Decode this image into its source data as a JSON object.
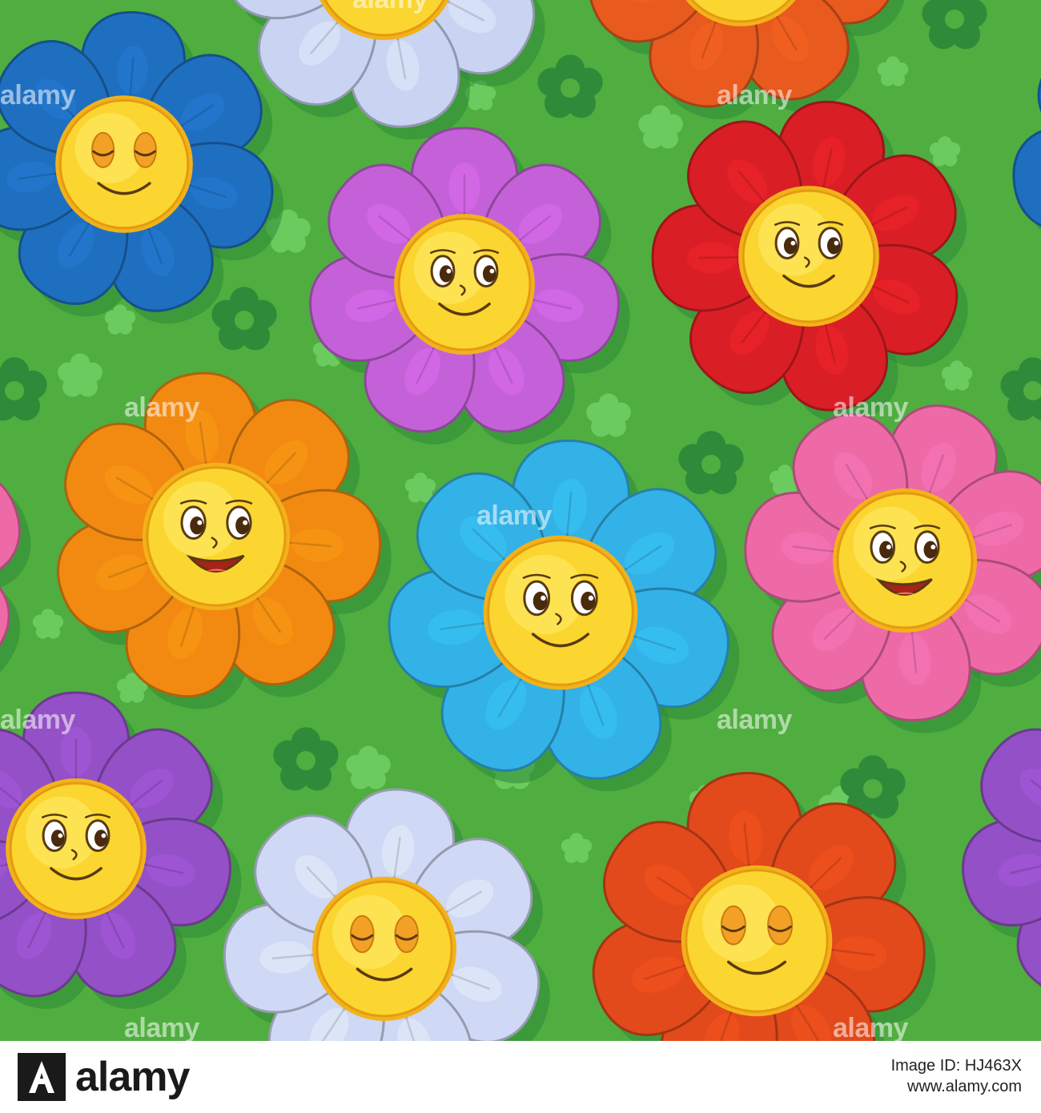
{
  "image": {
    "background_color": "#4fae3f",
    "watermark_text": "alamy",
    "flowers": [
      {
        "petal": "#1f6fc0",
        "face": "sleepy"
      },
      {
        "petal": "#c9d3f2",
        "face": "hidden"
      },
      {
        "petal": "#e85a1e",
        "face": "hidden"
      },
      {
        "petal": "#c561d8",
        "face": "happy"
      },
      {
        "petal": "#d91f25",
        "face": "happy"
      },
      {
        "petal": "#f28a12",
        "face": "laughing"
      },
      {
        "petal": "#33b2e8",
        "face": "happy"
      },
      {
        "petal": "#ee6aa7",
        "face": "laughing"
      },
      {
        "petal": "#9450c6",
        "face": "happy"
      },
      {
        "petal": "#cfd8f4",
        "face": "sleepy"
      },
      {
        "petal": "#e24a1b",
        "face": "sleepy"
      }
    ]
  },
  "footer": {
    "logo_text": "alamy",
    "image_id": "Image ID: HJ463X",
    "url": "www.alamy.com"
  }
}
